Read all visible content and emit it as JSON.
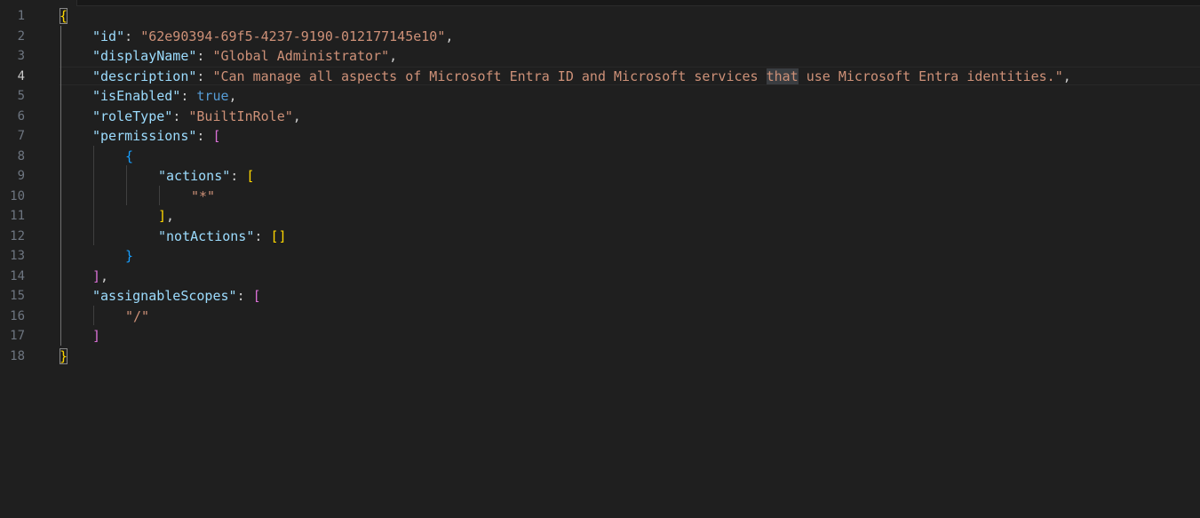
{
  "editor": {
    "line_numbers": [
      "1",
      "2",
      "3",
      "4",
      "5",
      "6",
      "7",
      "8",
      "9",
      "10",
      "11",
      "12",
      "13",
      "14",
      "15",
      "16",
      "17",
      "18"
    ],
    "active_line": "4",
    "highlighted_word": "that",
    "tokens": {
      "open_brace": "{",
      "close_brace": "}",
      "id_key": "\"id\"",
      "id_value": "\"62e90394-69f5-4237-9190-012177145e10\"",
      "displayName_key": "\"displayName\"",
      "displayName_value": "\"Global Administrator\"",
      "description_key": "\"description\"",
      "description_value_before": "\"Can manage all aspects of Microsoft Entra ID and Microsoft services ",
      "description_value_hl": "that",
      "description_value_after": " use Microsoft Entra identities.\"",
      "isEnabled_key": "\"isEnabled\"",
      "isEnabled_value": "true",
      "roleType_key": "\"roleType\"",
      "roleType_value": "\"BuiltInRole\"",
      "permissions_key": "\"permissions\"",
      "actions_key": "\"actions\"",
      "actions_item": "\"*\"",
      "notActions_key": "\"notActions\"",
      "notActions_value": "[]",
      "assignableScopes_key": "\"assignableScopes\"",
      "assignableScopes_item": "\"/\"",
      "open_bracket": "[",
      "close_bracket": "]",
      "close_bracket_comma": "],",
      "inner_open_brace": "{",
      "inner_close_brace": "}",
      "colon": ": ",
      "comma": ","
    }
  },
  "colors": {
    "background": "#1f1f1f",
    "key": "#9cdcfe",
    "string": "#ce9178",
    "boolean": "#569cd6",
    "bracket_level1": "#ffd700",
    "bracket_level2": "#da70d6",
    "bracket_level3": "#179fff",
    "line_number": "#6e7681",
    "line_number_active": "#cccccc"
  }
}
